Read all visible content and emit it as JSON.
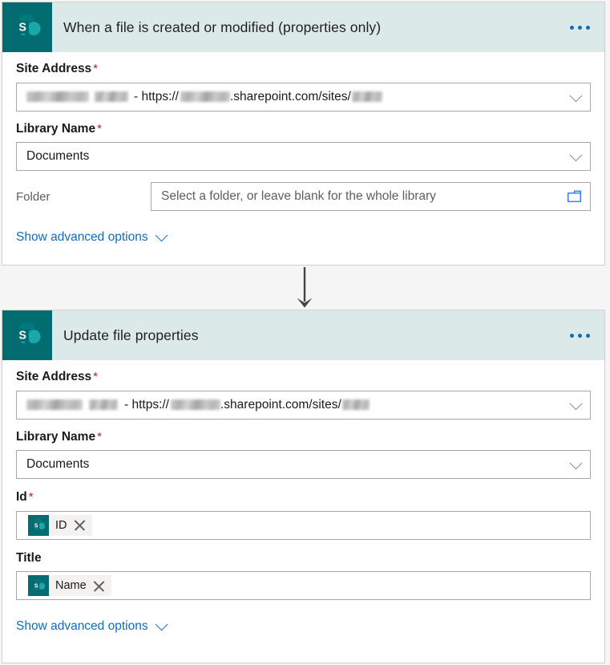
{
  "app": {
    "accent_blue": "#0f6cbd",
    "sharepoint_teal": "#036c70",
    "header_bg": "#dce9e9",
    "required_marker_color": "#a4262c"
  },
  "cards": [
    {
      "id": "trigger-card",
      "title": "When a file is created or modified (properties only)",
      "connector_icon": "sharepoint-icon",
      "overflow_icon": "ellipsis-icon",
      "fields": {
        "site_address": {
          "label": "Site Address",
          "required_marker": "*",
          "value_visible": "- https://",
          "value_suffix": ".sharepoint.com/sites/",
          "chevron_icon": "chevron-down-icon"
        },
        "library_name": {
          "label": "Library Name",
          "required_marker": "*",
          "value": "Documents",
          "chevron_icon": "chevron-down-icon"
        },
        "folder": {
          "label": "Folder",
          "placeholder": "Select a folder, or leave blank for the whole library",
          "picker_icon": "folder-icon"
        }
      },
      "advanced": {
        "label": "Show advanced options",
        "chevron_icon": "chevron-down-icon"
      }
    },
    {
      "id": "action-card",
      "title": "Update file properties",
      "connector_icon": "sharepoint-icon",
      "overflow_icon": "ellipsis-icon",
      "fields": {
        "site_address": {
          "label": "Site Address",
          "required_marker": "*",
          "value_visible": "- https://",
          "value_suffix": ".sharepoint.com/sites/",
          "chevron_icon": "chevron-down-icon"
        },
        "library_name": {
          "label": "Library Name",
          "required_marker": "*",
          "value": "Documents",
          "chevron_icon": "chevron-down-icon"
        },
        "id_field": {
          "label": "Id",
          "required_marker": "*",
          "token": {
            "text": "ID",
            "icon": "sharepoint-icon",
            "remove_icon": "close-icon"
          }
        },
        "title_field": {
          "label": "Title",
          "required_marker": "",
          "token": {
            "text": "Name",
            "icon": "sharepoint-icon",
            "remove_icon": "close-icon"
          }
        }
      },
      "advanced": {
        "label": "Show advanced options",
        "chevron_icon": "chevron-down-icon"
      }
    }
  ],
  "connector": {
    "icon": "arrow-down-icon"
  }
}
